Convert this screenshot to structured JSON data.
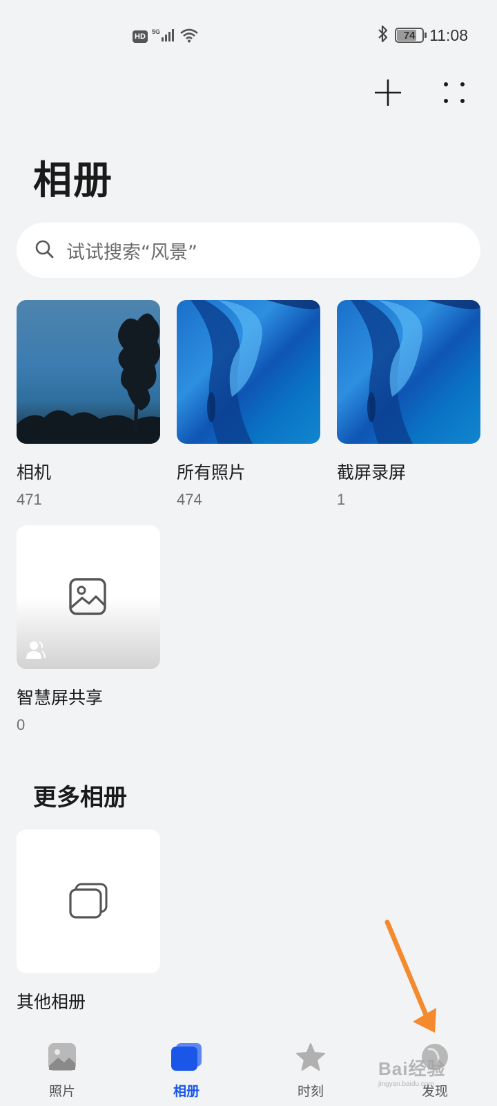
{
  "status_bar": {
    "hd": "HD",
    "network": "5G",
    "battery_level": "74",
    "battery_fraction": 0.74,
    "time": "11:08"
  },
  "header": {
    "title": "相册",
    "add_icon": "plus-icon",
    "more_icon": "more-dots-icon"
  },
  "search": {
    "placeholder": "试试搜索“风景”",
    "icon": "search-icon"
  },
  "albums": [
    {
      "name": "相机",
      "count": "471",
      "thumb": "sky-photo"
    },
    {
      "name": "所有照片",
      "count": "474",
      "thumb": "blue-wallpaper"
    },
    {
      "name": "截屏录屏",
      "count": "1",
      "thumb": "blue-wallpaper"
    },
    {
      "name": "智慧屏共享",
      "count": "0",
      "thumb": "image-placeholder-icon"
    }
  ],
  "more_albums": {
    "title": "更多相册",
    "items": [
      {
        "name": "其他相册",
        "thumb": "stacked-albums-icon"
      }
    ]
  },
  "bottom_nav": [
    {
      "label": "照片",
      "icon": "photo-icon",
      "active": false
    },
    {
      "label": "相册",
      "icon": "album-icon",
      "active": true
    },
    {
      "label": "时刻",
      "icon": "star-icon",
      "active": false
    },
    {
      "label": "发现",
      "icon": "discover-icon",
      "active": false
    }
  ],
  "annotation": {
    "arrow_color": "#f5892e"
  },
  "watermark": {
    "text": "Bai经验",
    "subtext": "jingyan.baidu.com"
  },
  "colors": {
    "accent": "#1a56e8",
    "background": "#f1f3f5"
  }
}
